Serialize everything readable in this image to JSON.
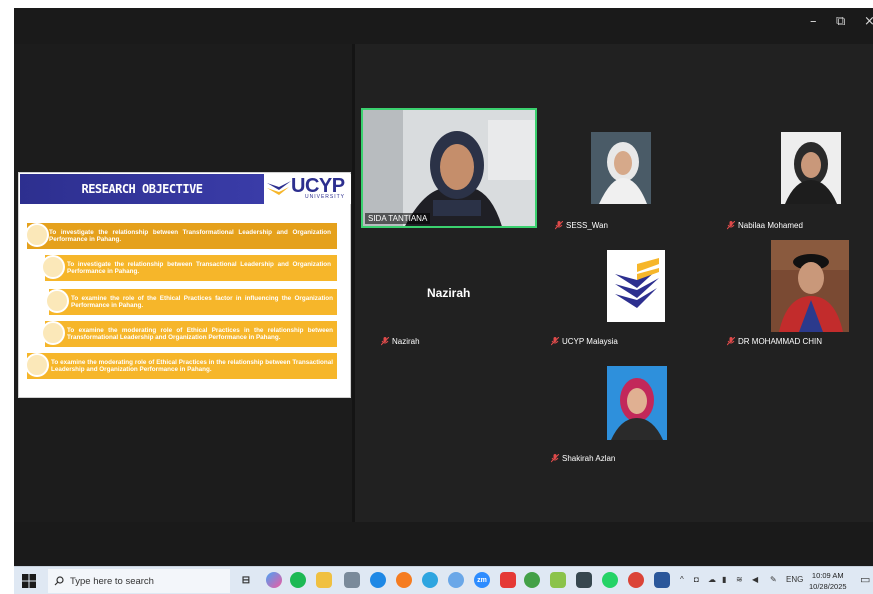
{
  "window": {
    "minimize_glyph": "–",
    "restore_glyph": "⧉",
    "close_glyph": "×"
  },
  "slide": {
    "title": "RESEARCH OBJECTIVE",
    "logo_text": "UCYP",
    "logo_sub": "UNIVERSITY",
    "objectives": [
      "To investigate the relationship between Transformational Leadership and Organization Performance in Pahang.",
      "To investigate the relationship between Transactional Leadership and Organization Performance in Pahang.",
      "To examine the role of the Ethical Practices factor in influencing the Organization Performance in Pahang.",
      "To examine the moderating role of Ethical Practices in the relationship between Transformational Leadership and Organization Performance in Pahang.",
      "To examine the moderating role of Ethical Practices in the relationship between Transactional Leadership and Organization Performance in Pahang."
    ]
  },
  "participants": [
    {
      "name": "SIDA TANTIANA",
      "active_speaker": true
    },
    {
      "name": "SESS_Wan",
      "muted": true
    },
    {
      "name": "Nabilaa Mohamed",
      "muted": true
    },
    {
      "name": "Nazirah",
      "muted": true,
      "center_label": "Nazirah"
    },
    {
      "name": "UCYP Malaysia",
      "muted": true
    },
    {
      "name": "DR MOHAMMAD CHIN",
      "muted": true
    },
    {
      "name": "Shakirah Azlan",
      "muted": true
    }
  ],
  "taskbar": {
    "search_placeholder": "Type here to search",
    "language": "ENG",
    "time": "10:09 AM",
    "date": "10/28/2025",
    "zoom_label": "zm"
  },
  "colors": {
    "slide_header": "#2d2f8f",
    "objective_bar": "#f6b62a",
    "active_speaker_border": "#3bd16f",
    "zoom_bg": "#1f1f1f",
    "taskbar_bg": "#dfe8f3"
  }
}
